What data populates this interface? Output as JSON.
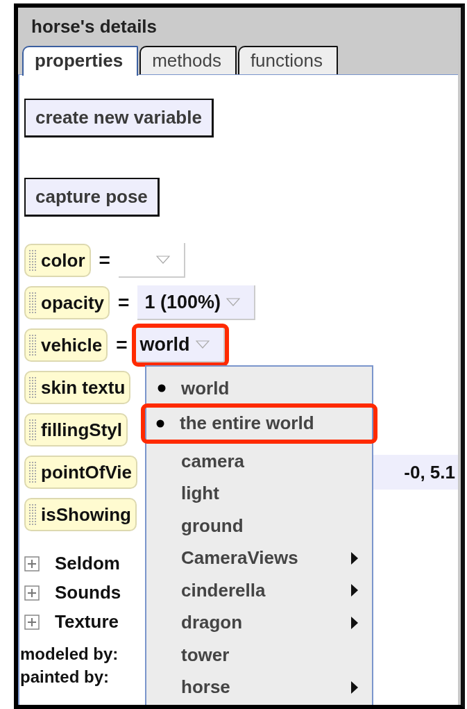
{
  "panel": {
    "title": "horse's details",
    "tabs": [
      {
        "label": "properties",
        "selected": true
      },
      {
        "label": "methods",
        "selected": false
      },
      {
        "label": "functions",
        "selected": false
      }
    ],
    "buttons": [
      {
        "label": "create new variable"
      },
      {
        "label": "capture pose"
      }
    ],
    "properties": [
      {
        "name": "color",
        "operator": "=",
        "dropdown": true
      },
      {
        "name": "opacity",
        "operator": "=",
        "value": "1 (100%)",
        "dropdown": true
      },
      {
        "name": "vehicle",
        "operator": "=",
        "value": "world",
        "dropdown": true,
        "highlighted": true
      },
      {
        "name": "skin textu"
      },
      {
        "name": "fillingStyl"
      },
      {
        "name": "pointOfVie",
        "value": "-0, 5.1"
      },
      {
        "name": "isShowing"
      }
    ],
    "groups": [
      {
        "label": "Seldom",
        "expanded": false
      },
      {
        "label": "Sounds",
        "expanded": false
      },
      {
        "label": "Texture",
        "expanded": false
      }
    ],
    "credits": [
      "modeled by:",
      "painted by:"
    ],
    "menu": [
      {
        "label": "world",
        "bullet": true,
        "submenu": false,
        "highlighted": false
      },
      {
        "label": "the entire world",
        "bullet": true,
        "submenu": false,
        "highlighted": true
      },
      {
        "label": "camera",
        "bullet": false,
        "submenu": false,
        "highlighted": false
      },
      {
        "label": "light",
        "bullet": false,
        "submenu": false,
        "highlighted": false
      },
      {
        "label": "ground",
        "bullet": false,
        "submenu": false,
        "highlighted": false
      },
      {
        "label": "CameraViews",
        "bullet": false,
        "submenu": true,
        "highlighted": false
      },
      {
        "label": "cinderella",
        "bullet": false,
        "submenu": true,
        "highlighted": false
      },
      {
        "label": "dragon",
        "bullet": false,
        "submenu": true,
        "highlighted": false
      },
      {
        "label": "tower",
        "bullet": false,
        "submenu": false,
        "highlighted": false
      },
      {
        "label": "horse",
        "bullet": false,
        "submenu": true,
        "highlighted": false
      }
    ]
  }
}
